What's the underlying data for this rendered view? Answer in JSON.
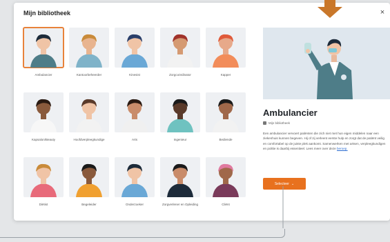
{
  "modal": {
    "title": "Mijn bibliotheek",
    "close_glyph": "×"
  },
  "grid": [
    {
      "label": "Ambulancier",
      "selected": true
    },
    {
      "label": "Kantoorbeheerder"
    },
    {
      "label": "Kinesist"
    },
    {
      "label": "Zorgcoördinator"
    },
    {
      "label": "Kapper"
    },
    {
      "label": "Kapsalon/Beauty"
    },
    {
      "label": "Hoofdverpleegkundige"
    },
    {
      "label": "Arts"
    },
    {
      "label": "Ingenieur"
    },
    {
      "label": "Bediende"
    },
    {
      "label": "Diëtist"
    },
    {
      "label": "Begeleider"
    },
    {
      "label": "Onderzoeker"
    },
    {
      "label": "Zorgverlener en Opleiding"
    },
    {
      "label": "Cliënt"
    }
  ],
  "detail": {
    "title": "Ambulancier",
    "meta": "Mijn bibliotheek",
    "description": "Een ambulancier vervoert patiënten die zich niet met hun eigen middelen naar een ziekenhuis kunnen begeven. Hij of zij verleent eerste hulp en zorgt dat de patiënt veilig en comfortabel op de juiste plek aankomt. Samenwerken met artsen, verpleegkundigen en politie is daarbij essentieel. Lees meer over deze",
    "link": "beroep.",
    "cta": "Selecteer"
  },
  "colors": {
    "accent": "#e8711e",
    "selected_outline": "#e8823a",
    "arrow": "#c9772a"
  },
  "icons": {
    "close": "close-icon",
    "arrow": "arrow-down-icon",
    "cta_chevron": "chevron-down-icon"
  }
}
